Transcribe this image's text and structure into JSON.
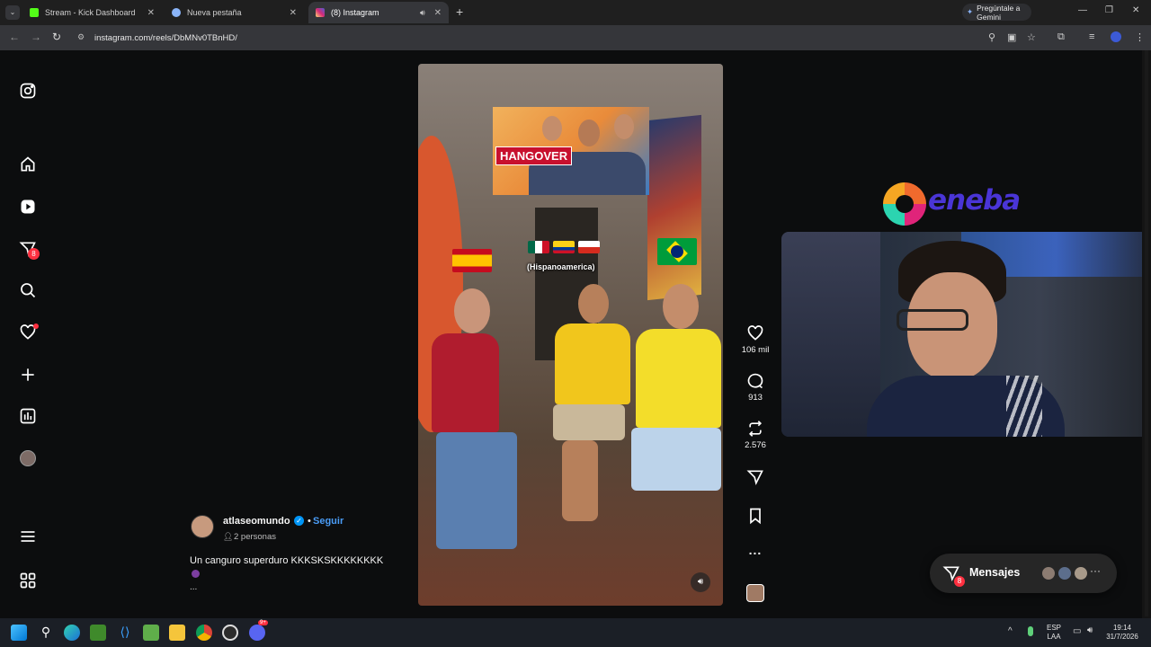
{
  "browser": {
    "tabs": [
      {
        "title": "Stream - Kick Dashboard",
        "active": false
      },
      {
        "title": "Nueva pestaña",
        "active": false
      },
      {
        "title": "(8) Instagram",
        "active": true
      }
    ],
    "new_tab": "+",
    "gemini_button": "Pregúntale a Gemini",
    "url": "instagram.com/reels/DbMNv0TBnHD/"
  },
  "sidebar": {
    "notifications_badge": "8",
    "items": [
      "instagram-logo",
      "home",
      "reels",
      "messages",
      "search",
      "notifications",
      "create",
      "dashboard",
      "profile",
      "more",
      "also-from-meta"
    ]
  },
  "reel": {
    "poster_title": "HANGOVER",
    "overlay_text": "(Hispanoamerica)"
  },
  "actions": {
    "likes": "106 mil",
    "comments": "913",
    "reposts": "2.576",
    "more": "..."
  },
  "post": {
    "username": "atlaseomundo",
    "follow": "Seguir",
    "separator": "•",
    "people": "2 personas",
    "caption": "Un canguro superduro KKKSKSKKKKKKKK",
    "caption_more": "..."
  },
  "overlay": {
    "sponsor": "eneba"
  },
  "messages": {
    "label": "Mensajes",
    "badge": "8",
    "more": "···"
  },
  "taskbar": {
    "lang_top": "ESP",
    "lang_bottom": "LAA",
    "time": "19:14",
    "date": "31/7/2026",
    "discord_badge": "9+"
  }
}
